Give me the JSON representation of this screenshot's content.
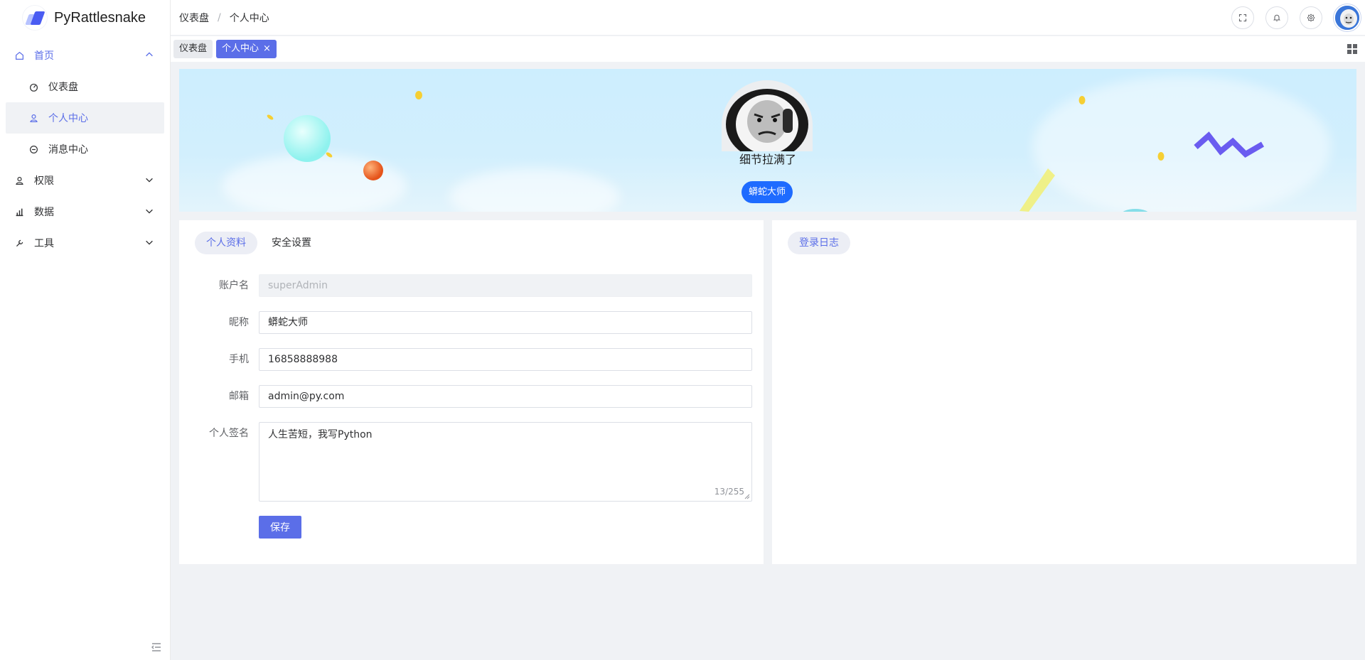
{
  "app": {
    "name": "PyRattlesnake"
  },
  "breadcrumb": [
    "仪表盘",
    "个人中心"
  ],
  "sidebar": {
    "items": [
      {
        "label": "首页",
        "icon": "home-icon",
        "expanded": true
      },
      {
        "label": "仪表盘",
        "icon": "dashboard-icon"
      },
      {
        "label": "个人中心",
        "icon": "user-icon",
        "selected": true
      },
      {
        "label": "消息中心",
        "icon": "message-icon"
      },
      {
        "label": "权限",
        "icon": "permission-icon"
      },
      {
        "label": "数据",
        "icon": "chart-icon"
      },
      {
        "label": "工具",
        "icon": "tool-icon"
      }
    ]
  },
  "tabs": [
    {
      "label": "仪表盘"
    },
    {
      "label": "个人中心",
      "close": "×",
      "active": true
    }
  ],
  "banner": {
    "nickname": "细节拉满了",
    "badge": "蟒蛇大师"
  },
  "profile": {
    "tabs": [
      "个人资料",
      "安全设置"
    ],
    "fields": {
      "account": {
        "label": "账户名",
        "value": "superAdmin"
      },
      "nickname": {
        "label": "昵称",
        "value": "蟒蛇大师"
      },
      "phone": {
        "label": "手机",
        "value": "16858888988"
      },
      "email": {
        "label": "邮箱",
        "value": "admin@py.com"
      },
      "signature": {
        "label": "个人签名",
        "value": "人生苦短，我写Python",
        "counter": "13/255"
      }
    },
    "save_label": "保存"
  },
  "log": {
    "tab": "登录日志"
  },
  "colors": {
    "primary": "#5b6ee8",
    "badge": "#1e6bff",
    "bg": "#f0f2f5"
  }
}
